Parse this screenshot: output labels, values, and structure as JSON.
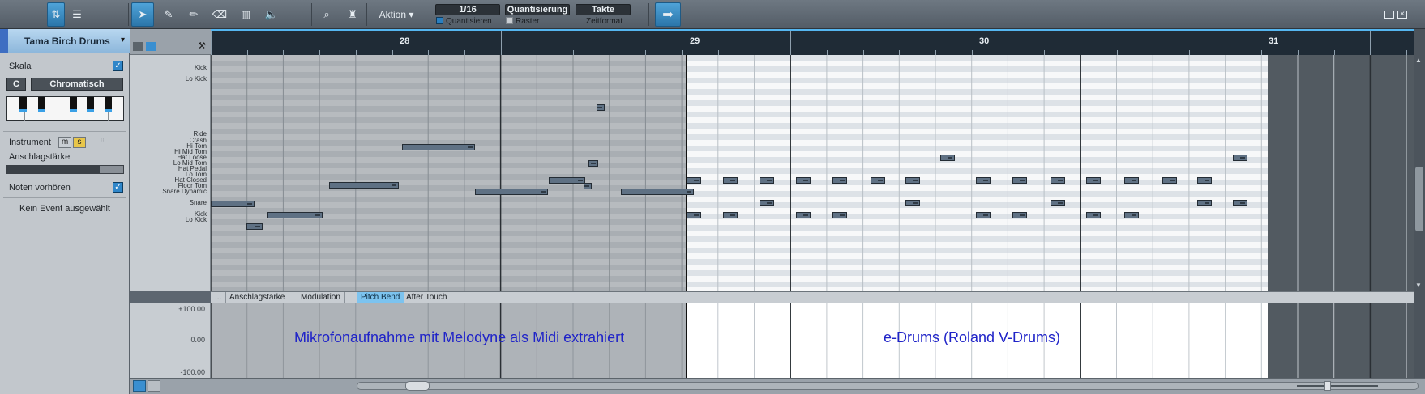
{
  "toolbar": {
    "tools": [
      "pointer-tool",
      "paint-tool",
      "pen-tool",
      "eraser-tool",
      "split-tool",
      "mute-tool",
      "listen-tool"
    ],
    "action_label": "Aktion",
    "quantize_value": "1/16",
    "quantize_label": "Quantisieren",
    "quantization_button": "Quantisierung",
    "raster_label": "Raster",
    "timeformat_button": "Takte",
    "timeformat_label": "Zeitformat"
  },
  "inspector": {
    "instrument_name": "Tama Birch Drums",
    "scale_label": "Skala",
    "scale_root": "C",
    "scale_type": "Chromatisch",
    "instrument_label": "Instrument",
    "mute_label": "m",
    "solo_label": "s",
    "velocity_label": "Anschlagstärke",
    "velocity_level": 0.8,
    "preview_label": "Noten vorhören",
    "no_event_label": "Kein Event ausgewählt"
  },
  "ruler": {
    "bars": [
      "28",
      "29",
      "30",
      "31"
    ]
  },
  "drum_labels": [
    "Kick",
    "Lo Kick",
    "Ride",
    "Crash",
    "Hi Tom",
    "Hi Mid Tom",
    "Hat Loose",
    "Lo Mid Tom",
    "Hat Pedal",
    "Lo Tom",
    "Hat Closed",
    "Floor Tom",
    "Snare Dynamic",
    "Snare",
    "Kick",
    "Lo Kick"
  ],
  "lane_tabs": [
    "...",
    "Anschlagstärke",
    "Modulation",
    "Pitch Bend",
    "After Touch"
  ],
  "selected_lane": "Pitch Bend",
  "lane_axis": [
    "+100.00",
    "0.00",
    "-100.00"
  ],
  "captions": {
    "left": "Mikrofonaufnahme mit Melodyne als Midi extrahiert",
    "right": "e-Drums  (Roland V-Drums)"
  },
  "colors": {
    "accent": "#2b8bd0",
    "note": "#5f7184",
    "caption": "#1f23c8"
  }
}
